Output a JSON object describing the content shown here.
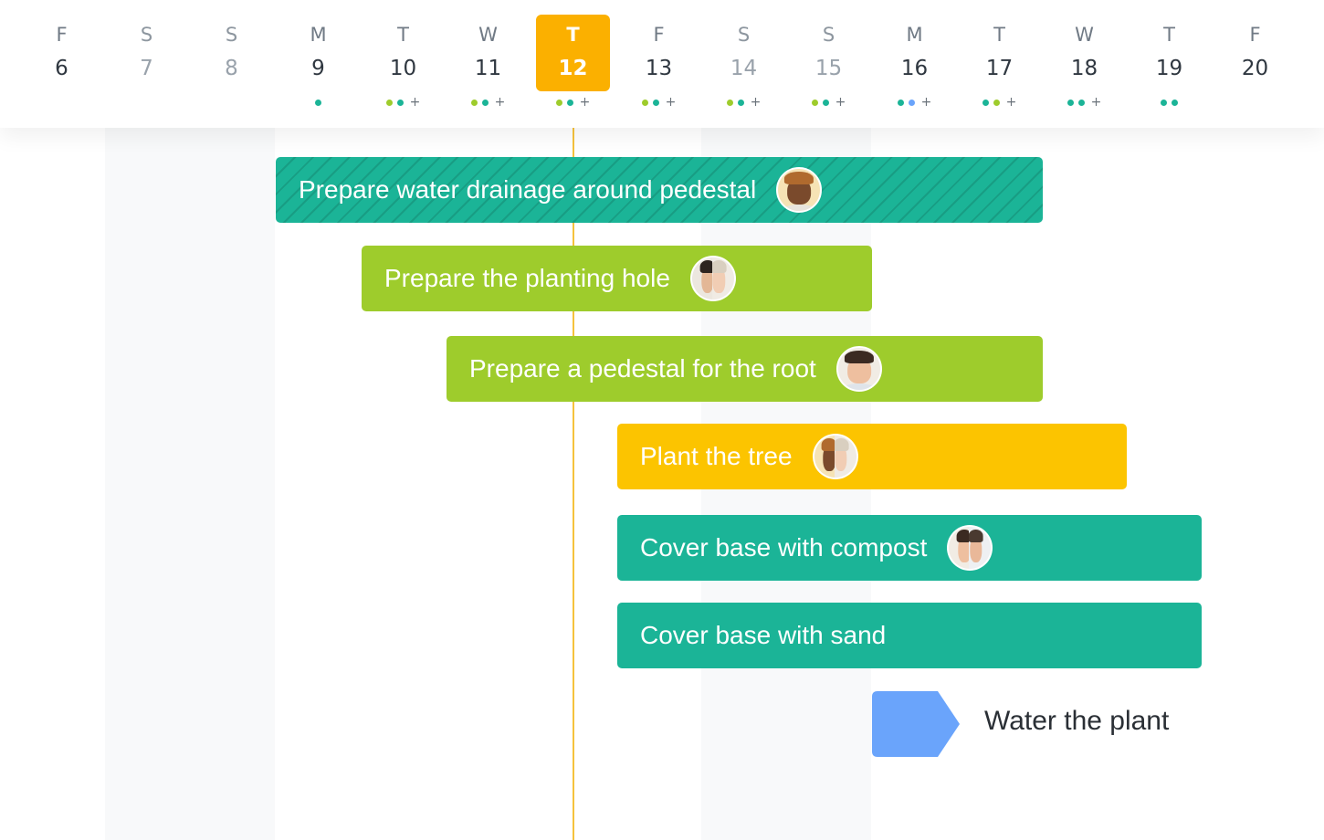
{
  "colors": {
    "teal": "#1bb497",
    "green": "#9ecc2c",
    "yellow": "#fcc400",
    "today": "#fbb000",
    "milestone": "#6aa4fb",
    "dot_green": "#9ecc2c",
    "dot_teal": "#1bb497",
    "dot_blue": "#6aa4fb"
  },
  "days": [
    {
      "letter": "F",
      "num": "6"
    },
    {
      "letter": "S",
      "num": "7"
    },
    {
      "letter": "S",
      "num": "8"
    },
    {
      "letter": "M",
      "num": "9"
    },
    {
      "letter": "T",
      "num": "10"
    },
    {
      "letter": "W",
      "num": "11"
    },
    {
      "letter": "T",
      "num": "12"
    },
    {
      "letter": "F",
      "num": "13"
    },
    {
      "letter": "S",
      "num": "14"
    },
    {
      "letter": "S",
      "num": "15"
    },
    {
      "letter": "M",
      "num": "16"
    },
    {
      "letter": "T",
      "num": "17"
    },
    {
      "letter": "W",
      "num": "18"
    },
    {
      "letter": "T",
      "num": "19"
    },
    {
      "letter": "F",
      "num": "20"
    }
  ],
  "tasks": [
    {
      "label": "Prepare water drainage around pedestal",
      "color": "teal",
      "style": "hatched"
    },
    {
      "label": "Prepare the planting hole",
      "color": "green"
    },
    {
      "label": "Prepare a pedestal for the root",
      "color": "green"
    },
    {
      "label": "Plant the tree",
      "color": "yellow"
    },
    {
      "label": "Cover base with compost",
      "color": "teal"
    },
    {
      "label": "Cover base with sand",
      "color": "teal"
    }
  ],
  "milestone": {
    "label": "Water the plant",
    "color": "milestone",
    "icon": "milestone-icon"
  },
  "day_indicator_plus": "+"
}
